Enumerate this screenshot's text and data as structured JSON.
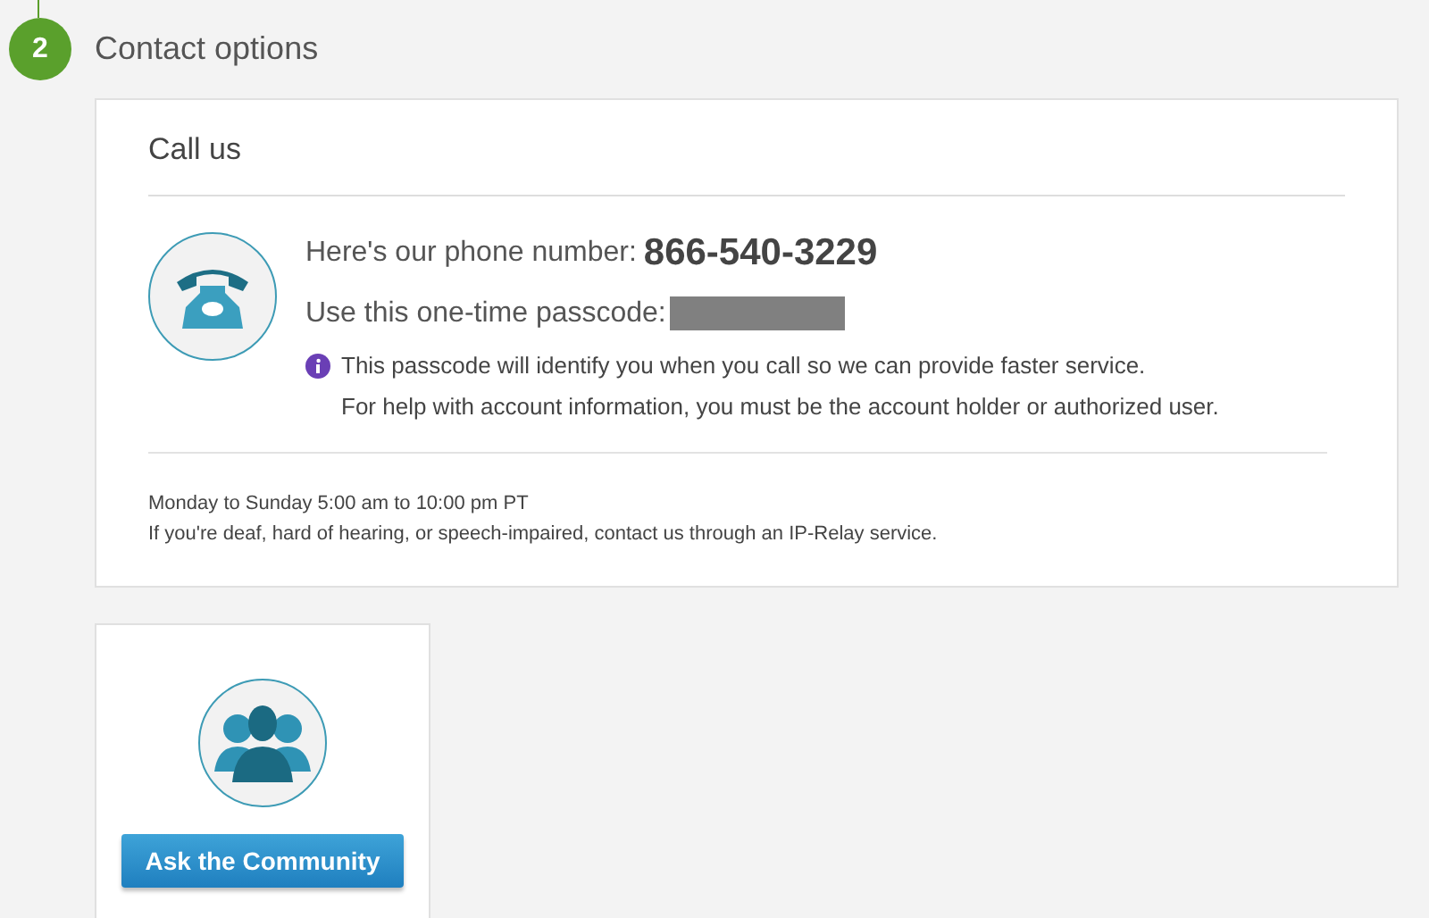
{
  "step": {
    "number": "2",
    "title": "Contact options"
  },
  "call_card": {
    "title": "Call us",
    "phone_label": "Here's our phone number:",
    "phone_number": "866-540-3229",
    "passcode_label": "Use this one-time passcode:",
    "passcode_redacted": true,
    "info_lines": [
      "This passcode will identify you when you call so we can provide faster service.",
      "For help with account information, you must be the account holder or authorized user."
    ],
    "hours": "Monday to Sunday 5:00 am to 10:00 pm PT",
    "accessibility_note": "If you're deaf, hard of hearing, or speech-impaired, contact us through an IP-Relay service."
  },
  "community_card": {
    "button": "Ask the Community"
  }
}
